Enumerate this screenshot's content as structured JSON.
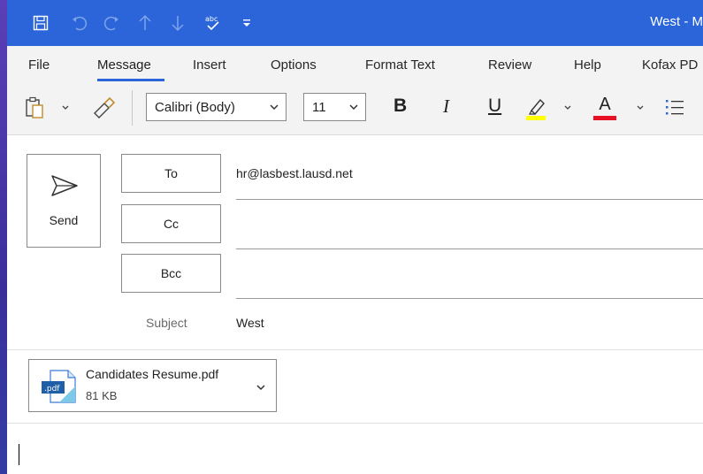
{
  "titlebar": {
    "title": "West - M"
  },
  "menu": {
    "tabs": [
      "File",
      "Message",
      "Insert",
      "Options",
      "Format Text",
      "Review",
      "Help",
      "Kofax PD"
    ],
    "active": "Message"
  },
  "ribbon": {
    "font_name": "Calibri (Body)",
    "font_size": "11",
    "bold": "B",
    "italic": "I",
    "underline": "U",
    "font_color": "A"
  },
  "compose": {
    "send_label": "Send",
    "to_label": "To",
    "cc_label": "Cc",
    "bcc_label": "Bcc",
    "to_value": "hr@lasbest.lausd.net",
    "cc_value": "",
    "bcc_value": "",
    "subject_label": "Subject",
    "subject_value": "West"
  },
  "attachment": {
    "name": "Candidates Resume.pdf",
    "size": "81 KB",
    "icon_text": ".pdf"
  },
  "colors": {
    "accent": "#2b65d9",
    "highlight": "#ffff00",
    "font_red": "#e81123"
  }
}
